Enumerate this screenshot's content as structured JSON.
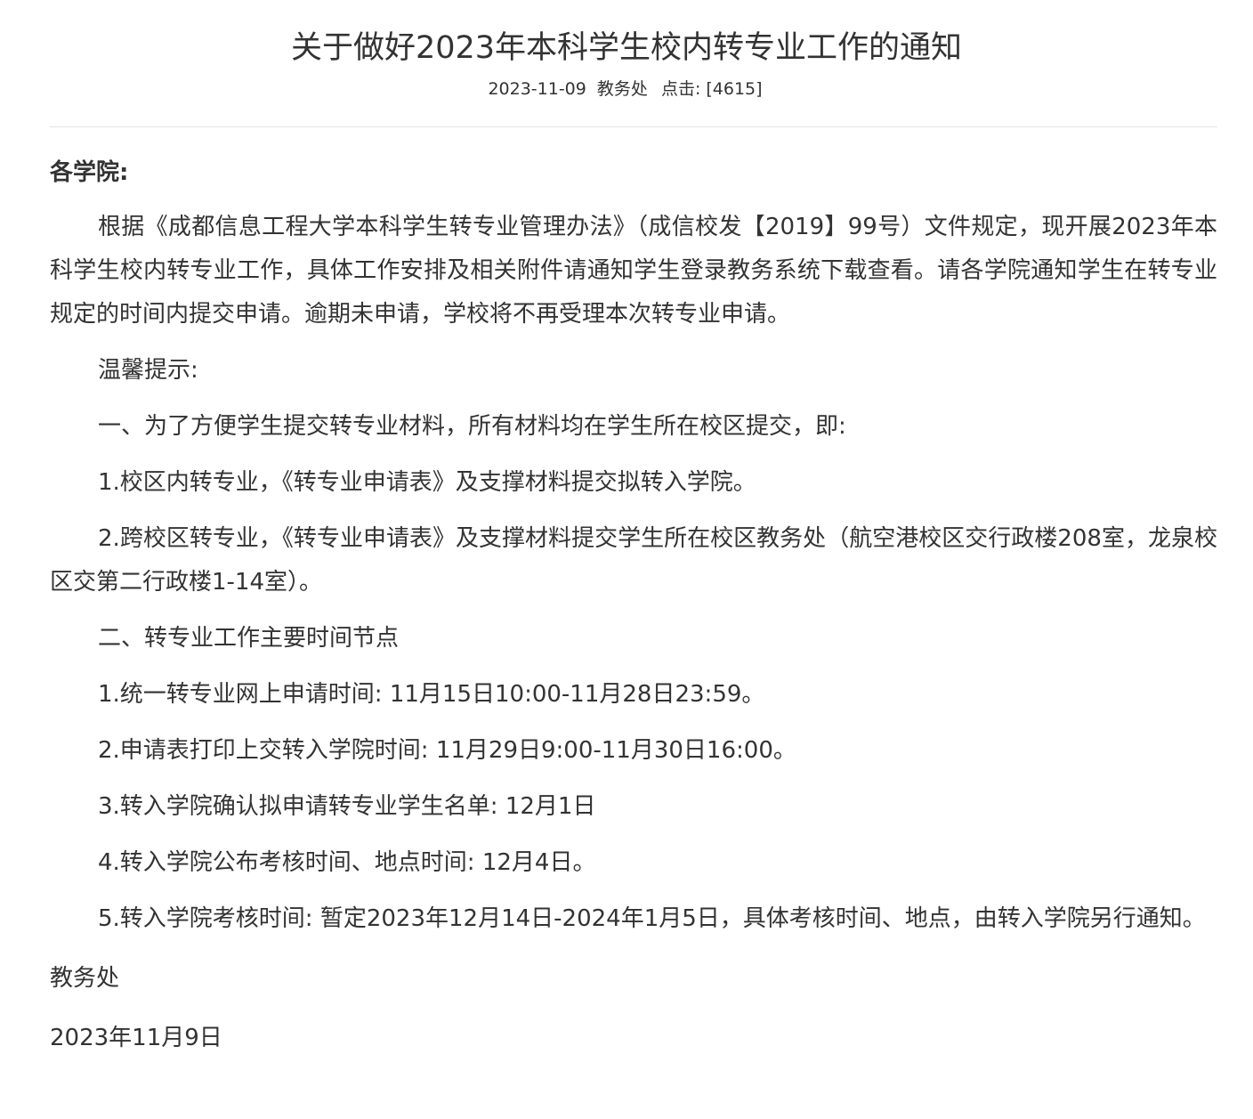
{
  "article": {
    "title": "关于做好2023年本科学生校内转专业工作的通知",
    "meta": {
      "date": "2023-11-09",
      "department": "教务处",
      "clicks_label": "点击:",
      "clicks_value": "[4615]"
    },
    "salutation": "各学院:",
    "paragraphs": [
      "根据《成都信息工程大学本科学生转专业管理办法》（成信校发【2019】99号）文件规定，现开展2023年本科学生校内转专业工作，具体工作安排及相关附件请通知学生登录教务系统下载查看。请各学院通知学生在转专业规定的时间内提交申请。逾期未申请，学校将不再受理本次转专业申请。",
      "温馨提示:",
      "一、为了方便学生提交转专业材料，所有材料均在学生所在校区提交，即:",
      "1.校区内转专业，《转专业申请表》及支撑材料提交拟转入学院。",
      "2.跨校区转专业，《转专业申请表》及支撑材料提交学生所在校区教务处（航空港校区交行政楼208室，龙泉校区交第二行政楼1-14室）。",
      "二、转专业工作主要时间节点",
      "1.统一转专业网上申请时间: 11月15日10:00-11月28日23:59。",
      "2.申请表打印上交转入学院时间: 11月29日9:00-11月30日16:00。",
      "3.转入学院确认拟申请转专业学生名单: 12月1日",
      "4.转入学院公布考核时间、地点时间: 12月4日。",
      "5.转入学院考核时间: 暂定2023年12月14日-2024年1月5日，具体考核时间、地点，由转入学院另行通知。"
    ],
    "signature": {
      "department": "教务处",
      "date": "2023年11月9日"
    }
  }
}
